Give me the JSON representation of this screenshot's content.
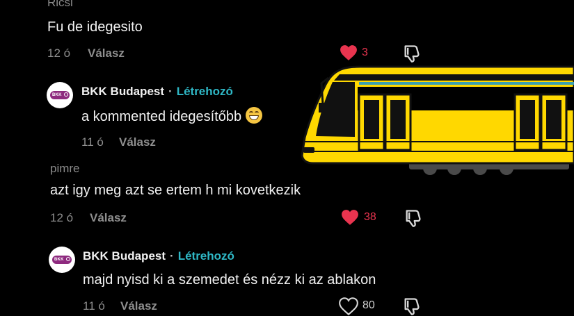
{
  "comments": [
    {
      "username": "Ricsi",
      "text": "Fu de idegesito",
      "age": "12 ó",
      "reply_label": "Válasz",
      "likes": "3",
      "liked": true
    },
    {
      "author": "BKK Budapest",
      "separator": "·",
      "creator_badge": "Létrehozó",
      "avatar_text": "BKK",
      "text": "a kommented idegesítőbb",
      "age": "11 ó",
      "reply_label": "Válasz"
    },
    {
      "username": "pimre",
      "text": "azt igy meg azt se ertem h mi kovetkezik",
      "age": "12 ó",
      "reply_label": "Válasz",
      "likes": "38",
      "liked": true
    },
    {
      "author": "BKK Budapest",
      "separator": "·",
      "creator_badge": "Létrehozó",
      "avatar_text": "BKK",
      "text": "majd nyisd ki a szemedet és nézz ki az ablakon",
      "age": "11 ó",
      "reply_label": "Válasz",
      "likes": "80",
      "liked": false
    }
  ],
  "colors": {
    "background": "#000000",
    "like_active": "#e8344f",
    "creator_badge": "#2fb8c6",
    "brand_purple": "#8e2a7f",
    "tram_yellow": "#ffd800"
  },
  "icons": [
    "heart-icon",
    "dislike-icon",
    "grinning-emoji",
    "bkk-logo",
    "tram-illustration"
  ]
}
